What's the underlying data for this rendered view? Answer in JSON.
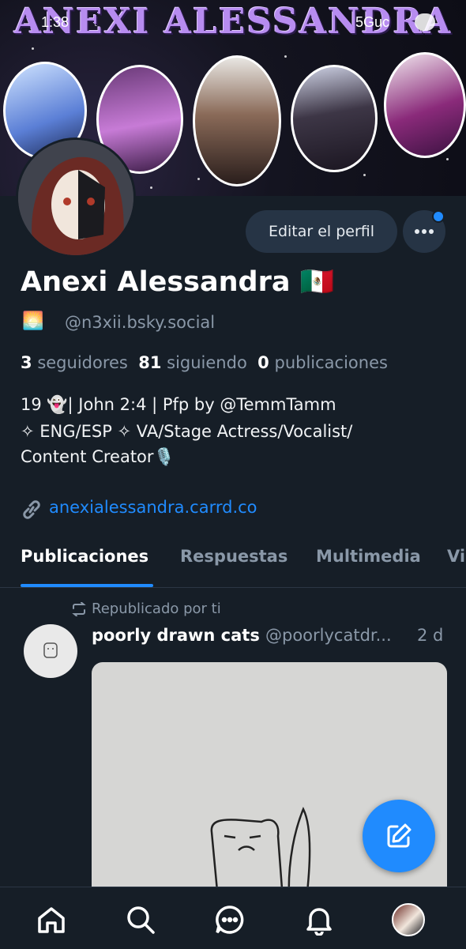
{
  "status_bar": {
    "time": "1:38",
    "network": "5Guc"
  },
  "banner": {
    "title": "ANEXI ALESSANDRA"
  },
  "profile": {
    "display_name": "Anexi Alessandra 🇲🇽",
    "handle_emoji": "🌅",
    "handle": "@n3xii.bsky.social",
    "edit_button": "Editar el perfil",
    "stats": {
      "followers_count": "3",
      "followers_label": "seguidores",
      "following_count": "81",
      "following_label": "siguiendo",
      "posts_count": "0",
      "posts_label": "publicaciones"
    },
    "bio_lines": [
      "19 👻| John 2:4 | Pfp by @TemmTamm",
      "✧ ENG/ESP ✧ VA/Stage Actress/Vocalist/",
      "Content Creator🎙️"
    ],
    "link": "anexialessandra.carrd.co"
  },
  "tabs": [
    "Publicaciones",
    "Respuestas",
    "Multimedia",
    "Vi"
  ],
  "post": {
    "repost_label": "Republicado por ti",
    "author": "poorly drawn cats",
    "author_handle": "@poorlycatdr...",
    "time": "2 d"
  },
  "colors": {
    "accent": "#208bfe",
    "background": "#161e27",
    "muted": "#8a98a8"
  },
  "icons": [
    "home-icon",
    "search-icon",
    "chat-icon",
    "bell-icon",
    "profile-avatar",
    "compose-icon",
    "more-icon",
    "repost-icon",
    "link-icon"
  ]
}
